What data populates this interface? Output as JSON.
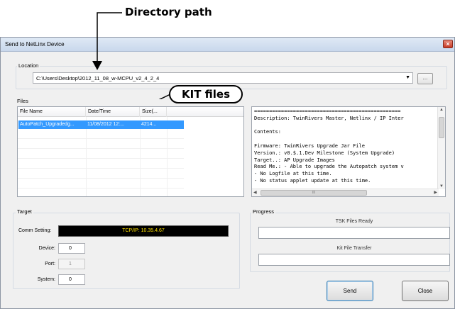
{
  "annotations": {
    "directory_path": "Directory path",
    "kit_files": "KIT files"
  },
  "window": {
    "title": "Send to NetLinx Device",
    "close_glyph": "×"
  },
  "location": {
    "label": "Location",
    "path": "C:\\Users\\Desktop\\2012_11_08_w-MCPU_v2_4_2_4",
    "browse_label": "..."
  },
  "files": {
    "label": "Files",
    "columns": [
      "File Name",
      "Date/Time",
      "Size(..."
    ],
    "rows": [
      {
        "name": "AutoPatch_Upgradedg...",
        "datetime": "11/08/2012  12:...",
        "size": "4214..."
      }
    ],
    "description": "=================================================\nDescription: TwinRivers Master, Netlinx / IP Inter\n\nContents:\n\nFirmware: TwinRivers Upgrade Jar File\nVersion.: v0.$.1.Dev Milestone (System Upgrade)\nTarget..: AP Upgrade Images\nRead Me.: - Able to upgrade the Autopatch system v\n- No Logfile at this time.\n- No status applet update at this time.",
    "scroll_glyph": "III"
  },
  "target": {
    "label": "Target",
    "comm_label": "Comm Setting:",
    "comm_value": "TCP/IP: 10.35.4.67",
    "device_label": "Device:",
    "device_value": "0",
    "port_label": "Port:",
    "port_value": "1",
    "system_label": "System:",
    "system_value": "0"
  },
  "progress": {
    "label": "Progress",
    "tsk_label": "TSK Files Ready",
    "tsk_value": 0,
    "kit_label": "Kit File Transfer",
    "kit_value": 0
  },
  "buttons": {
    "send": "Send",
    "close": "Close"
  }
}
